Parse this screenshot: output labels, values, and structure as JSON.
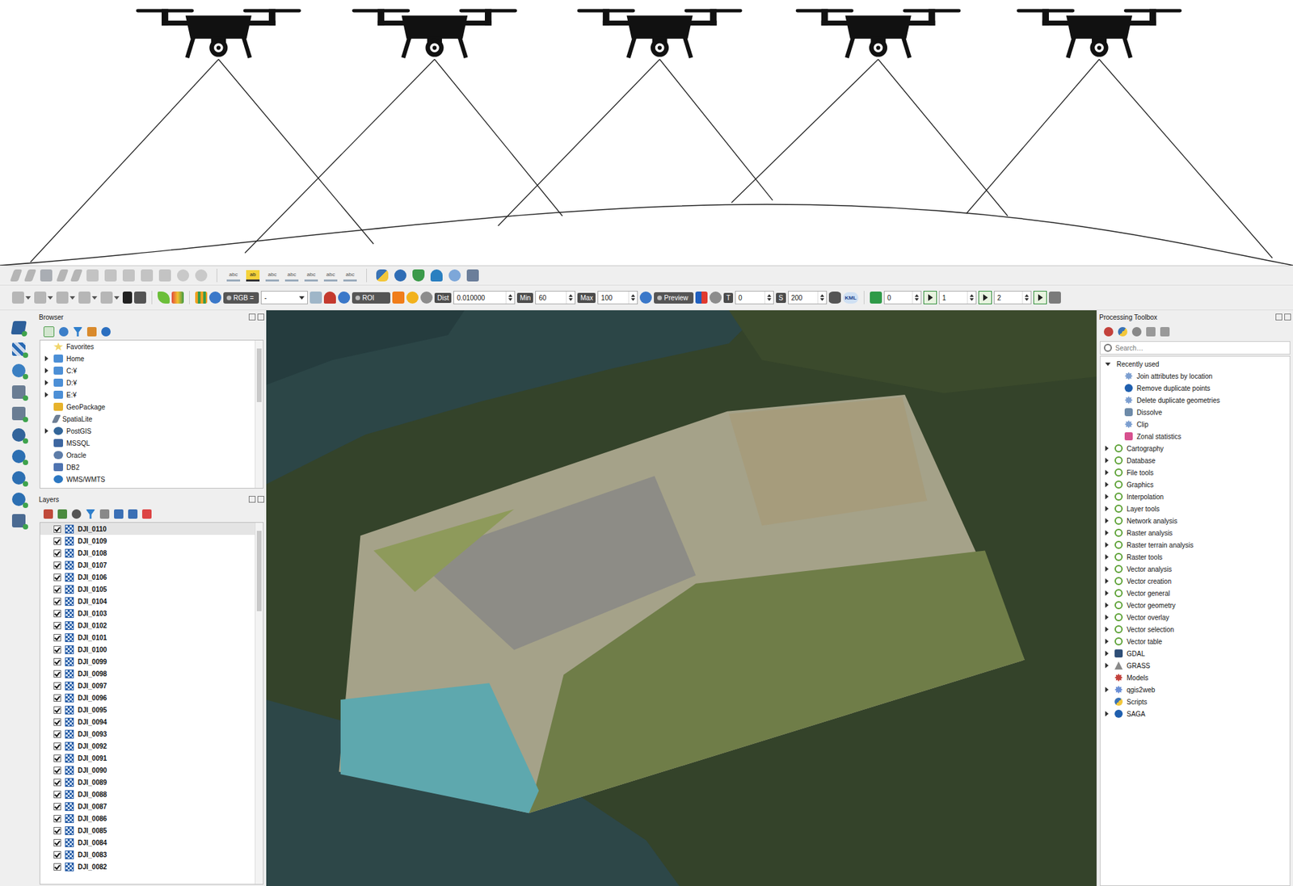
{
  "toolbar1": {
    "label_icons": [
      {
        "text": "abc",
        "highlighted": false
      },
      {
        "text": "ab",
        "highlighted": true
      },
      {
        "text": "abc",
        "highlighted": false
      },
      {
        "text": "abc",
        "highlighted": false
      },
      {
        "text": "abc",
        "highlighted": false
      },
      {
        "text": "abc",
        "highlighted": false
      },
      {
        "text": "abc",
        "highlighted": false
      }
    ]
  },
  "toolbar2": {
    "band_label": "RGB =",
    "band_value": "-",
    "roi_label": "ROI",
    "dist_label": "Dist",
    "dist_value": "0.010000",
    "min_label": "Min",
    "min_value": "60",
    "max_label": "Max",
    "max_value": "100",
    "preview_label": "Preview",
    "t_label": "T",
    "t_value": "0",
    "s_label": "S",
    "s_value": "200",
    "kml_label": "KML",
    "spin_values": [
      "0",
      "1",
      "2"
    ]
  },
  "browser": {
    "title": "Browser",
    "items": [
      {
        "label": "Favorites",
        "kind": "favorites",
        "expandable": false,
        "expanded": false
      },
      {
        "label": "Home",
        "kind": "folder",
        "expandable": true,
        "expanded": false
      },
      {
        "label": "C:¥",
        "kind": "folder",
        "expandable": true,
        "expanded": false
      },
      {
        "label": "D:¥",
        "kind": "folder",
        "expandable": true,
        "expanded": false
      },
      {
        "label": "E:¥",
        "kind": "folder",
        "expandable": true,
        "expanded": false
      },
      {
        "label": "GeoPackage",
        "kind": "geopackage",
        "expandable": false,
        "expanded": false
      },
      {
        "label": "SpatiaLite",
        "kind": "spatialite",
        "expandable": false,
        "expanded": false
      },
      {
        "label": "PostGIS",
        "kind": "postgis",
        "expandable": true,
        "expanded": false
      },
      {
        "label": "MSSQL",
        "kind": "mssql",
        "expandable": false,
        "expanded": false
      },
      {
        "label": "Oracle",
        "kind": "oracle",
        "expandable": false,
        "expanded": false
      },
      {
        "label": "DB2",
        "kind": "db2",
        "expandable": false,
        "expanded": false
      },
      {
        "label": "WMS/WMTS",
        "kind": "wms",
        "expandable": false,
        "expanded": false
      }
    ]
  },
  "layers": {
    "title": "Layers",
    "items": [
      {
        "name": "DJI_0110",
        "checked": true,
        "selected": true
      },
      {
        "name": "DJI_0109",
        "checked": true,
        "selected": false
      },
      {
        "name": "DJI_0108",
        "checked": true,
        "selected": false
      },
      {
        "name": "DJI_0107",
        "checked": true,
        "selected": false
      },
      {
        "name": "DJI_0106",
        "checked": true,
        "selected": false
      },
      {
        "name": "DJI_0105",
        "checked": true,
        "selected": false
      },
      {
        "name": "DJI_0104",
        "checked": true,
        "selected": false
      },
      {
        "name": "DJI_0103",
        "checked": true,
        "selected": false
      },
      {
        "name": "DJI_0102",
        "checked": true,
        "selected": false
      },
      {
        "name": "DJI_0101",
        "checked": true,
        "selected": false
      },
      {
        "name": "DJI_0100",
        "checked": true,
        "selected": false
      },
      {
        "name": "DJI_0099",
        "checked": true,
        "selected": false
      },
      {
        "name": "DJI_0098",
        "checked": true,
        "selected": false
      },
      {
        "name": "DJI_0097",
        "checked": true,
        "selected": false
      },
      {
        "name": "DJI_0096",
        "checked": true,
        "selected": false
      },
      {
        "name": "DJI_0095",
        "checked": true,
        "selected": false
      },
      {
        "name": "DJI_0094",
        "checked": true,
        "selected": false
      },
      {
        "name": "DJI_0093",
        "checked": true,
        "selected": false
      },
      {
        "name": "DJI_0092",
        "checked": true,
        "selected": false
      },
      {
        "name": "DJI_0091",
        "checked": true,
        "selected": false
      },
      {
        "name": "DJI_0090",
        "checked": true,
        "selected": false
      },
      {
        "name": "DJI_0089",
        "checked": true,
        "selected": false
      },
      {
        "name": "DJI_0088",
        "checked": true,
        "selected": false
      },
      {
        "name": "DJI_0087",
        "checked": true,
        "selected": false
      },
      {
        "name": "DJI_0086",
        "checked": true,
        "selected": false
      },
      {
        "name": "DJI_0085",
        "checked": true,
        "selected": false
      },
      {
        "name": "DJI_0084",
        "checked": true,
        "selected": false
      },
      {
        "name": "DJI_0083",
        "checked": true,
        "selected": false
      },
      {
        "name": "DJI_0082",
        "checked": true,
        "selected": false
      }
    ]
  },
  "processing": {
    "title": "Processing Toolbox",
    "search_placeholder": "Search…",
    "recent": {
      "label": "Recently used",
      "expanded": true,
      "items": [
        {
          "label": "Join attributes by location",
          "kind": "gear"
        },
        {
          "label": "Remove duplicate points",
          "kind": "saga"
        },
        {
          "label": "Delete duplicate geometries",
          "kind": "gear"
        },
        {
          "label": "Dissolve",
          "kind": "dissolve"
        },
        {
          "label": "Clip",
          "kind": "gear"
        },
        {
          "label": "Zonal statistics",
          "kind": "zonal"
        }
      ]
    },
    "groups": [
      {
        "label": "Cartography",
        "kind": "qgis",
        "expandable": true
      },
      {
        "label": "Database",
        "kind": "qgis",
        "expandable": true
      },
      {
        "label": "File tools",
        "kind": "qgis",
        "expandable": true
      },
      {
        "label": "Graphics",
        "kind": "qgis",
        "expandable": true
      },
      {
        "label": "Interpolation",
        "kind": "qgis",
        "expandable": true
      },
      {
        "label": "Layer tools",
        "kind": "qgis",
        "expandable": true
      },
      {
        "label": "Network analysis",
        "kind": "qgis",
        "expandable": true
      },
      {
        "label": "Raster analysis",
        "kind": "qgis",
        "expandable": true
      },
      {
        "label": "Raster terrain analysis",
        "kind": "qgis",
        "expandable": true
      },
      {
        "label": "Raster tools",
        "kind": "qgis",
        "expandable": true
      },
      {
        "label": "Vector analysis",
        "kind": "qgis",
        "expandable": true
      },
      {
        "label": "Vector creation",
        "kind": "qgis",
        "expandable": true
      },
      {
        "label": "Vector general",
        "kind": "qgis",
        "expandable": true
      },
      {
        "label": "Vector geometry",
        "kind": "qgis",
        "expandable": true
      },
      {
        "label": "Vector overlay",
        "kind": "qgis",
        "expandable": true
      },
      {
        "label": "Vector selection",
        "kind": "qgis",
        "expandable": true
      },
      {
        "label": "Vector table",
        "kind": "qgis",
        "expandable": true
      },
      {
        "label": "GDAL",
        "kind": "gdal",
        "expandable": true
      },
      {
        "label": "GRASS",
        "kind": "grass",
        "expandable": true
      },
      {
        "label": "Models",
        "kind": "models",
        "expandable": false
      },
      {
        "label": "qgis2web",
        "kind": "web",
        "expandable": true
      },
      {
        "label": "Scripts",
        "kind": "scripts",
        "expandable": false
      },
      {
        "label": "SAGA",
        "kind": "saga",
        "expandable": true
      }
    ]
  }
}
